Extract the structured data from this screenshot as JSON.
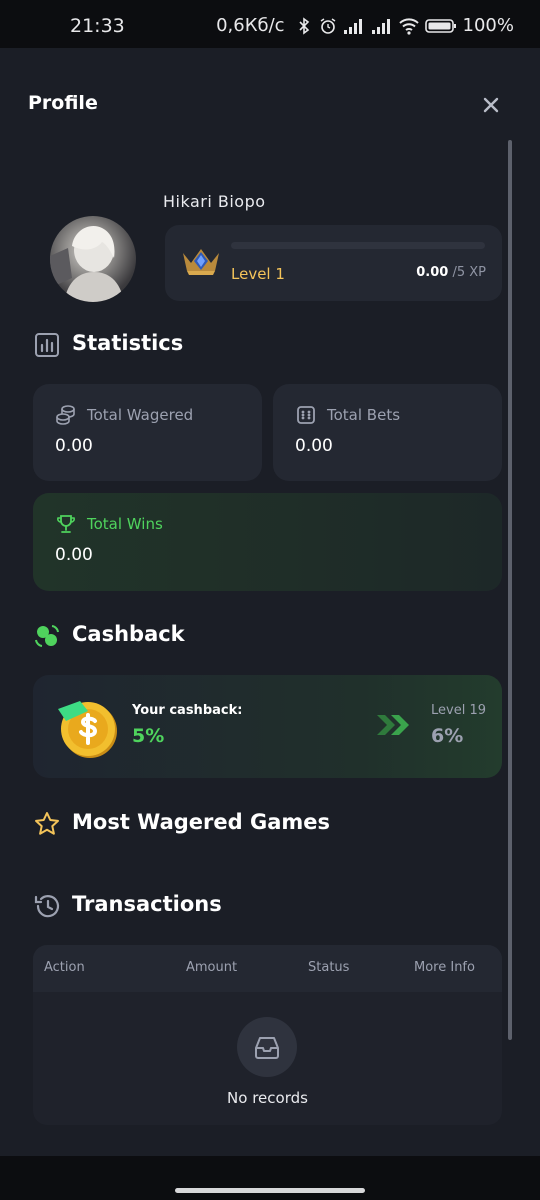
{
  "status_bar": {
    "time": "21:33",
    "network_speed": "0,6Кб/с",
    "battery": "100%"
  },
  "panel": {
    "title": "Profile"
  },
  "user": {
    "name": "Hikari Biopo",
    "level": "Level 1",
    "xp_current": "0.00",
    "xp_max": " /5 XP",
    "xp_progress": 0
  },
  "statistics": {
    "title": "Statistics",
    "total_wagered_label": "Total Wagered",
    "total_wagered_value": "0.00",
    "total_bets_label": "Total Bets",
    "total_bets_value": "0.00",
    "total_wins_label": "Total Wins",
    "total_wins_value": "0.00"
  },
  "cashback": {
    "title": "Cashback",
    "your_label": "Your cashback:",
    "your_value": "5%",
    "next_level_label": "Level 19",
    "next_level_value": "6%"
  },
  "most_wagered": {
    "title": "Most Wagered Games"
  },
  "transactions": {
    "title": "Transactions",
    "columns": [
      "Action",
      "Amount",
      "Status",
      "More Info"
    ],
    "empty_text": "No records"
  },
  "colors": {
    "accent_green": "#4fd35d",
    "level_gold": "#f4c45a",
    "panel_bg": "#1b1e26",
    "card_bg": "#242832"
  },
  "icons": [
    "bluetooth-icon",
    "alarm-icon",
    "signal-icon",
    "wifi-icon",
    "battery-icon",
    "close-icon",
    "level-badge-icon",
    "bar-chart-icon",
    "coins-stack-icon",
    "dice-icon",
    "trophy-icon",
    "cashback-icon",
    "dollar-coin-icon",
    "double-chevron-right-icon",
    "star-icon",
    "history-icon",
    "inbox-tray-icon"
  ]
}
